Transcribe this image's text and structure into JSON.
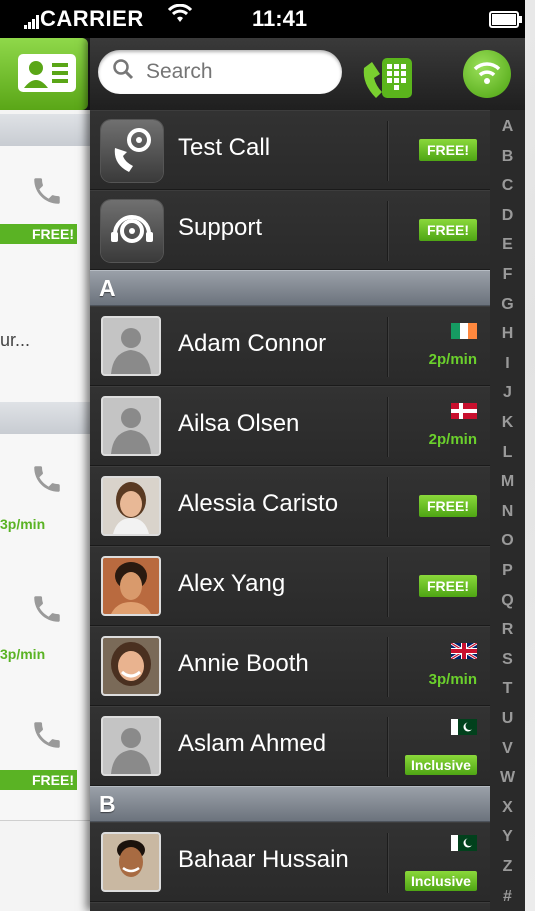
{
  "status_bar": {
    "carrier": "CARRIER",
    "time": "11:41"
  },
  "search": {
    "placeholder": "Search"
  },
  "peek": {
    "free_label": "FREE!",
    "truncated_text": "ur...",
    "rate_1": "3p/min",
    "rate_2": "3p/min",
    "free_label_2": "FREE!"
  },
  "rows": [
    {
      "name": "Test Call",
      "tag": "FREE!"
    },
    {
      "name": "Support",
      "tag": "FREE!"
    }
  ],
  "sections": {
    "a": "A",
    "b": "B"
  },
  "contacts": [
    {
      "name": "Adam Connor",
      "flag": "ireland",
      "rate": "2p/min"
    },
    {
      "name": "Ailsa Olsen",
      "flag": "denmark",
      "rate": "2p/min"
    },
    {
      "name": "Alessia Caristo",
      "tag": "FREE!"
    },
    {
      "name": "Alex Yang",
      "tag": "FREE!"
    },
    {
      "name": "Annie Booth",
      "flag": "uk",
      "rate": "3p/min"
    },
    {
      "name": "Aslam Ahmed",
      "flag": "pakistan",
      "tag": "Inclusive"
    },
    {
      "name": "Bahaar Hussain",
      "flag": "pakistan",
      "tag": "Inclusive"
    }
  ],
  "index_letters": [
    "A",
    "B",
    "C",
    "D",
    "E",
    "F",
    "G",
    "H",
    "I",
    "J",
    "K",
    "L",
    "M",
    "N",
    "O",
    "P",
    "Q",
    "R",
    "S",
    "T",
    "U",
    "V",
    "W",
    "X",
    "Y",
    "Z",
    "#"
  ],
  "colors": {
    "accent": "#5ab324",
    "panel": "#2a2a2a",
    "section": "#7a818a"
  }
}
